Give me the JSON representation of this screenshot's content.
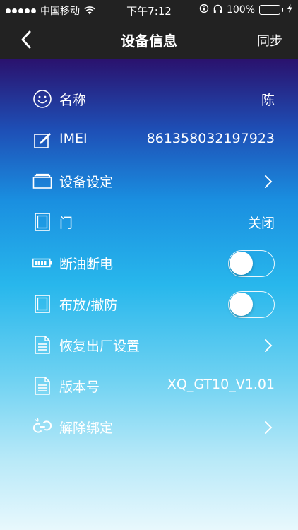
{
  "status_bar": {
    "carrier": "中国移动",
    "time": "下午7:12",
    "battery": "100%",
    "battery_level": 1.0
  },
  "nav": {
    "title": "设备信息",
    "sync_label": "同步"
  },
  "rows": [
    {
      "label": "名称",
      "value": "陈",
      "icon": "smiley-icon"
    },
    {
      "label": "IMEI",
      "value": "861358032197923",
      "icon": "edit-icon"
    },
    {
      "label": "设备设定",
      "value": "",
      "icon": "folder-icon",
      "chevron": true
    },
    {
      "label": "门",
      "value": "关闭",
      "icon": "door-icon"
    },
    {
      "label": "断油断电",
      "value": "",
      "icon": "battery-icon",
      "toggle": false
    },
    {
      "label": "布放/撤防",
      "value": "",
      "icon": "door-icon",
      "toggle": false
    },
    {
      "label": "恢复出厂设置",
      "value": "",
      "icon": "document-icon",
      "chevron": true
    },
    {
      "label": "版本号",
      "value": "XQ_GT10_V1.01",
      "icon": "document-icon"
    },
    {
      "label": "解除绑定",
      "value": "",
      "icon": "unlink-icon",
      "chevron": true
    }
  ]
}
